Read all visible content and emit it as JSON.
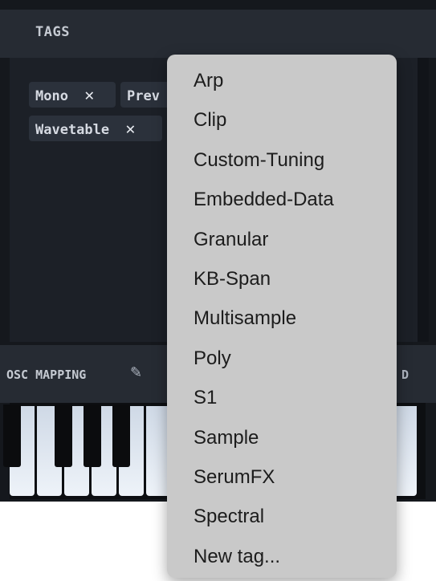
{
  "tags_section": {
    "title": "TAGS",
    "chips": [
      {
        "label": "Mono",
        "close_icon": "✕"
      },
      {
        "label": "Prev",
        "close_icon": "✕"
      },
      {
        "label": "Wavetable",
        "close_icon": "✕"
      }
    ]
  },
  "osc_mapping": {
    "title": "OSC MAPPING",
    "edit_icon": "pencil-icon",
    "right_label": "D"
  },
  "dropdown_menu": {
    "items": [
      "Arp",
      "Clip",
      "Custom-Tuning",
      "Embedded-Data",
      "Granular",
      "KB-Span",
      "Multisample",
      "Poly",
      "S1",
      "Sample",
      "SerumFX",
      "Spectral",
      "New tag..."
    ]
  }
}
